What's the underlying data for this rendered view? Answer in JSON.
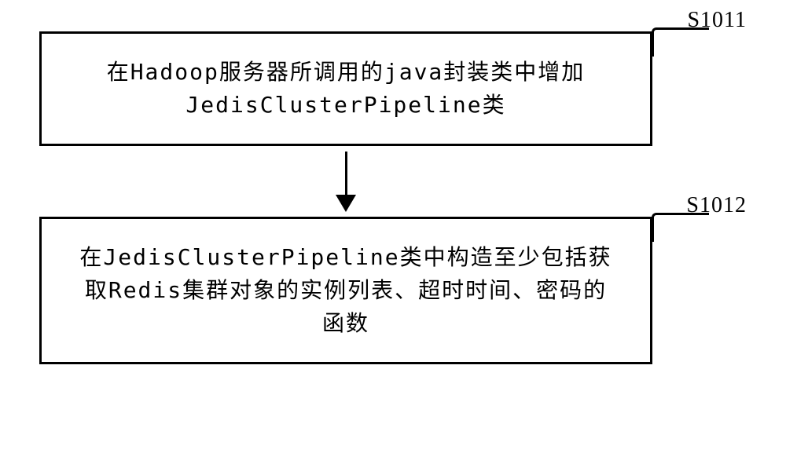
{
  "steps": [
    {
      "label": "S1011",
      "text": "在Hadoop服务器所调用的java封装类中增加JedisClusterPipeline类"
    },
    {
      "label": "S1012",
      "text": "在JedisClusterPipeline类中构造至少包括获取Redis集群对象的实例列表、超时时间、密码的函数"
    }
  ]
}
